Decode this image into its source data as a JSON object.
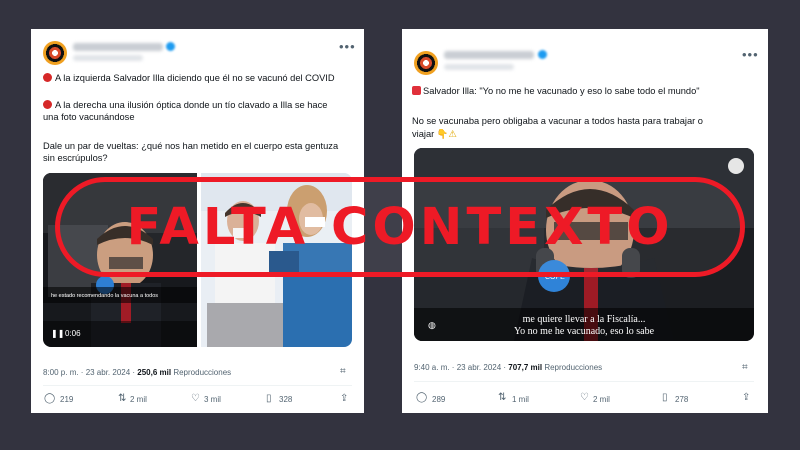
{
  "left_tweet": {
    "lines": [
      "A la izquierda Salvador Illa diciendo que él no se vacunó del COVID",
      "A la derecha una ilusión óptica donde un tío clavado a Illa se hace",
      "una foto vacunándose",
      "Dale un par de vueltas: ¿qué nos han metido en el cuerpo esta gentuza",
      "sin escrúpulos?"
    ],
    "video_time": "0:06",
    "video_caption": "he estado recomendando la vacuna a todos",
    "time": "8:00 p. m.",
    "date": "23 abr. 2024",
    "views": "250,6 mil",
    "views_label": "Reproducciones",
    "replies": "219",
    "retweets": "2 mil",
    "likes": "3 mil",
    "bookmarks": "328"
  },
  "right_tweet": {
    "line1": "Salvador Illa: \"Yo no me he vacunado y eso lo sabe todo el mundo\"",
    "line2": "No se vacunaba pero obligaba a vacunar a todos hasta para trabajar o",
    "line3": "viajar",
    "subtitle1": "me quiere llevar a la Fiscalía...",
    "subtitle2": "Yo no me he vacunado, eso lo sabe",
    "mic_brand": "COPE",
    "time": "9:40 a. m.",
    "date": "23 abr. 2024",
    "views": "707,7 mil",
    "views_label": "Reproducciones",
    "replies": "289",
    "retweets": "1 mil",
    "likes": "2 mil",
    "bookmarks": "278"
  },
  "stamp": {
    "text": "FALTA CONTEXTO",
    "color": "#ee1a26"
  },
  "icons": [
    "more-icon",
    "reply-icon",
    "retweet-icon",
    "like-icon",
    "bookmark-icon",
    "share-icon",
    "community-notes-icon",
    "pause-icon",
    "globe-icon"
  ]
}
